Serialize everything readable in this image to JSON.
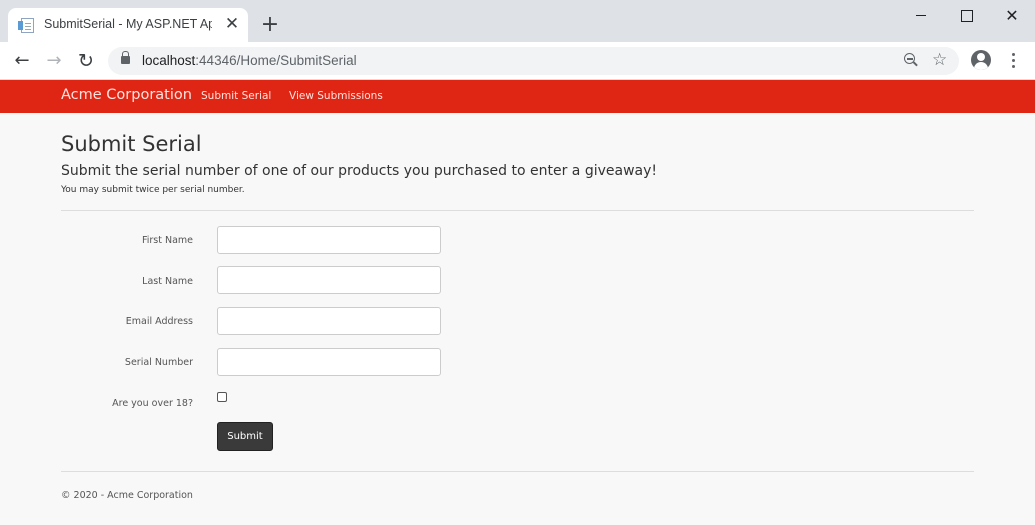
{
  "browser": {
    "tab_title": "SubmitSerial - My ASP.NET Application",
    "tab_close": "✕",
    "new_tab": "+",
    "url_host": "localhost",
    "url_rest": ":44346/Home/SubmitSerial",
    "back_icon": "←",
    "forward_icon": "→",
    "reload_icon": "↻",
    "star_icon": "☆",
    "close_window_icon": "✕"
  },
  "navbar": {
    "brand": "Acme Corporation",
    "links": [
      "Submit Serial",
      "View Submissions"
    ],
    "color": "#df2514"
  },
  "page": {
    "title": "Submit Serial",
    "subtitle": "Submit the serial number of one of our products you purchased to enter a giveaway!",
    "note": "You may submit twice per serial number."
  },
  "form": {
    "first_name_label": "First Name",
    "last_name_label": "Last Name",
    "email_label": "Email Address",
    "serial_label": "Serial Number",
    "age_label": "Are you over 18?",
    "first_name_value": "",
    "last_name_value": "",
    "email_value": "",
    "serial_value": "",
    "over18_checked": false,
    "submit_label": "Submit"
  },
  "footer": {
    "text": "© 2020 - Acme Corporation"
  }
}
